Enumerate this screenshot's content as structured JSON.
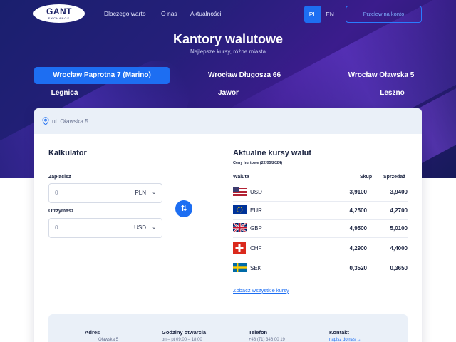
{
  "nav": {
    "logo_top": "GANT",
    "logo_bottom": "EXCHANGE",
    "links": [
      "Dlaczego warto",
      "O nas",
      "Aktualności"
    ],
    "lang_active": "PL",
    "lang_other": "EN",
    "cta": "Przelew na konto"
  },
  "hero": {
    "title": "Kantory walutowe",
    "subtitle": "Najlepsze kursy, różne miasta"
  },
  "locations": [
    "Wrocław Paprotna 7 (Marino)",
    "Wrocław Długosza 66",
    "Wrocław Oławska 5",
    "Legnica",
    "Jawor",
    "Leszno"
  ],
  "address_bar": "ul. Oławska 5",
  "calculator": {
    "title": "Kalkulator",
    "pay_label": "Zapłacisz",
    "pay_value": "0",
    "pay_currency": "PLN",
    "receive_label": "Otrzymasz",
    "receive_value": "0",
    "receive_currency": "USD"
  },
  "rates": {
    "title": "Aktualne kursy walut",
    "subtitle": "Ceny hurtowe  (22/05/2024)",
    "col_currency": "Waluta",
    "col_buy": "Skup",
    "col_sell": "Sprzedaż",
    "rows": [
      {
        "code": "USD",
        "buy": "3,9100",
        "sell": "3,9400"
      },
      {
        "code": "EUR",
        "buy": "4,2500",
        "sell": "4,2700"
      },
      {
        "code": "GBP",
        "buy": "4,9500",
        "sell": "5,0100"
      },
      {
        "code": "CHF",
        "buy": "4,2900",
        "sell": "4,4000"
      },
      {
        "code": "SEK",
        "buy": "0,3520",
        "sell": "0,3650"
      }
    ],
    "all_link": "Zobacz wszystkie kursy"
  },
  "info": {
    "address_h": "Adres",
    "address_v": "Oławska 5",
    "hours_h": "Godziny otwarcia",
    "hours_v": "pn – pt   09:00 – 18:00",
    "phone_h": "Telefon",
    "phone_v": "+48 (71) 346 00 19",
    "contact_h": "Kontakt",
    "contact_v": "napisz do nas  →"
  },
  "colors": {
    "accent": "#1d6ef2",
    "hero_bg": "#1a1f6e",
    "text": "#1a2340"
  }
}
